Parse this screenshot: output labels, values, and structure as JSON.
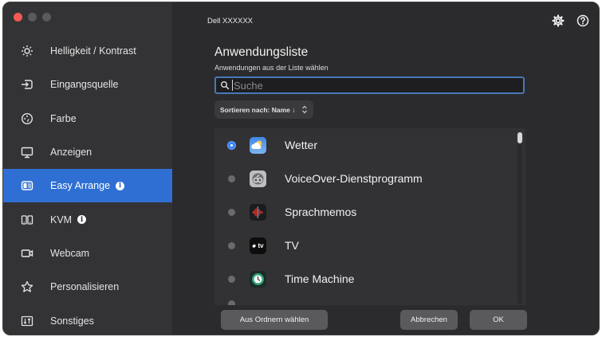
{
  "window": {
    "device_name": "Dell XXXXXX"
  },
  "sidebar": {
    "items": [
      {
        "label": "Helligkeit / Kontrast",
        "icon": "brightness-icon"
      },
      {
        "label": "Eingangsquelle",
        "icon": "input-source-icon"
      },
      {
        "label": "Farbe",
        "icon": "color-palette-icon"
      },
      {
        "label": "Anzeigen",
        "icon": "display-icon"
      },
      {
        "label": "Easy Arrange",
        "icon": "easy-arrange-icon",
        "active": true,
        "info_badge": "i"
      },
      {
        "label": "KVM",
        "icon": "kvm-icon",
        "info_badge": "i"
      },
      {
        "label": "Webcam",
        "icon": "webcam-icon"
      },
      {
        "label": "Personalisieren",
        "icon": "star-icon"
      },
      {
        "label": "Sonstiges",
        "icon": "misc-icon"
      }
    ]
  },
  "header": {
    "icons": [
      "settings-gear-icon",
      "help-icon"
    ]
  },
  "main": {
    "title": "Anwendungsliste",
    "subtitle": "Anwendungen aus der Liste wählen",
    "search": {
      "placeholder": "Suche",
      "value": ""
    },
    "sort": {
      "label": "Sortieren nach: Name ↓"
    },
    "apps": [
      {
        "name": "Wetter",
        "icon": "weather-icon",
        "selected": true
      },
      {
        "name": "VoiceOver-Dienstprogramm",
        "icon": "voiceover-utility-icon",
        "selected": false
      },
      {
        "name": "Sprachmemos",
        "icon": "voice-memos-icon",
        "selected": false
      },
      {
        "name": "TV",
        "icon": "apple-tv-icon",
        "selected": false
      },
      {
        "name": "Time Machine",
        "icon": "time-machine-icon",
        "selected": false
      }
    ],
    "tv_logo_text": "tv"
  },
  "buttons": {
    "choose_folder": "Aus Ordnern wählen",
    "cancel": "Abbrechen",
    "ok": "OK"
  },
  "colors": {
    "accent": "#2f6fd3",
    "sidebar_bg": "#333336",
    "main_bg": "#2b2b2d",
    "close_button": "#f05a52"
  }
}
